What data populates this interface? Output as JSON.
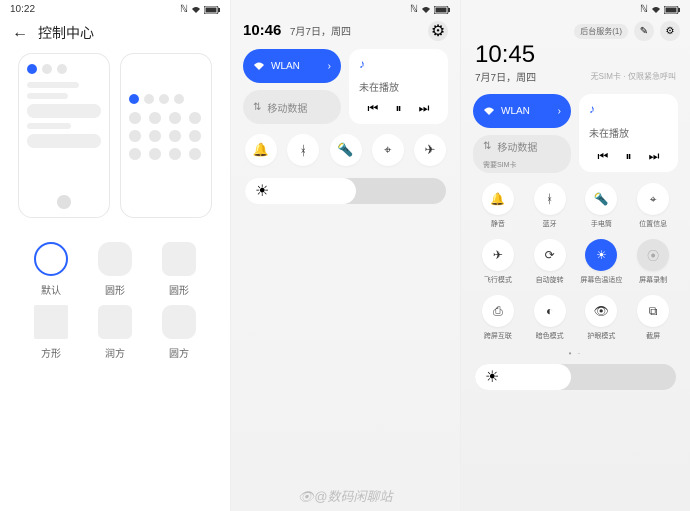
{
  "panelA": {
    "status_time": "10:22",
    "title": "控制中心",
    "shapes": [
      {
        "key": "circle",
        "label": "默认",
        "selected": true
      },
      {
        "key": "squircle",
        "label": "圆形",
        "selected": false
      },
      {
        "key": "rounded",
        "label": "圆形",
        "selected": false
      },
      {
        "key": "square",
        "label": "方形",
        "selected": false
      },
      {
        "key": "rsq",
        "label": "润方",
        "selected": false
      },
      {
        "key": "pill",
        "label": "圆方",
        "selected": false
      }
    ]
  },
  "panelB": {
    "status_time": "10:46",
    "date": "7月7日，周四",
    "wlan_label": "WLAN",
    "data_label": "移动数据",
    "media_title": "未在播放",
    "quick": [
      {
        "key": "bell",
        "icon": "bell-icon",
        "label": ""
      },
      {
        "key": "bt",
        "icon": "bluetooth-icon",
        "label": ""
      },
      {
        "key": "torch",
        "icon": "flashlight-icon",
        "label": ""
      },
      {
        "key": "loc",
        "icon": "location-icon",
        "label": ""
      },
      {
        "key": "air",
        "icon": "airplane-icon",
        "label": ""
      }
    ],
    "brightness_pct": 55
  },
  "panelC": {
    "clock": "10:45",
    "date": "7月7日，周四",
    "service_chip": "后台服务(1)",
    "sim_note": "无SIM卡 · 仅限紧急呼叫",
    "wlan_label": "WLAN",
    "data_label": "移动数据",
    "data_sub": "需要SIM卡",
    "media_title": "未在播放",
    "toggles": [
      {
        "key": "bell",
        "label": "静音",
        "icon": "bell-icon",
        "state": "off"
      },
      {
        "key": "bt",
        "label": "蓝牙",
        "icon": "bluetooth-icon",
        "state": "off"
      },
      {
        "key": "torch",
        "label": "手电筒",
        "icon": "flashlight-icon",
        "state": "off"
      },
      {
        "key": "loc",
        "label": "位置信息",
        "icon": "location-icon",
        "state": "off"
      },
      {
        "key": "air",
        "label": "飞行模式",
        "icon": "airplane-icon",
        "state": "off"
      },
      {
        "key": "rot",
        "label": "自动旋转",
        "icon": "rotate-icon",
        "state": "off"
      },
      {
        "key": "screen",
        "label": "屏幕色温适应",
        "icon": "sun-icon",
        "state": "on"
      },
      {
        "key": "rec",
        "label": "屏幕录制",
        "icon": "record-icon",
        "state": "disabled"
      },
      {
        "key": "cast",
        "label": "跨屏互联",
        "icon": "cast-icon",
        "state": "off"
      },
      {
        "key": "dark",
        "label": "暗色模式",
        "icon": "moon-icon",
        "state": "off"
      },
      {
        "key": "eye",
        "label": "护眼模式",
        "icon": "eye-icon",
        "state": "off"
      },
      {
        "key": "shot",
        "label": "截屏",
        "icon": "screenshot-icon",
        "state": "off"
      }
    ],
    "brightness_pct": 48,
    "pager": "• ·"
  },
  "watermark": "@数码闲聊站",
  "colors": {
    "accent": "#2a62ff"
  }
}
